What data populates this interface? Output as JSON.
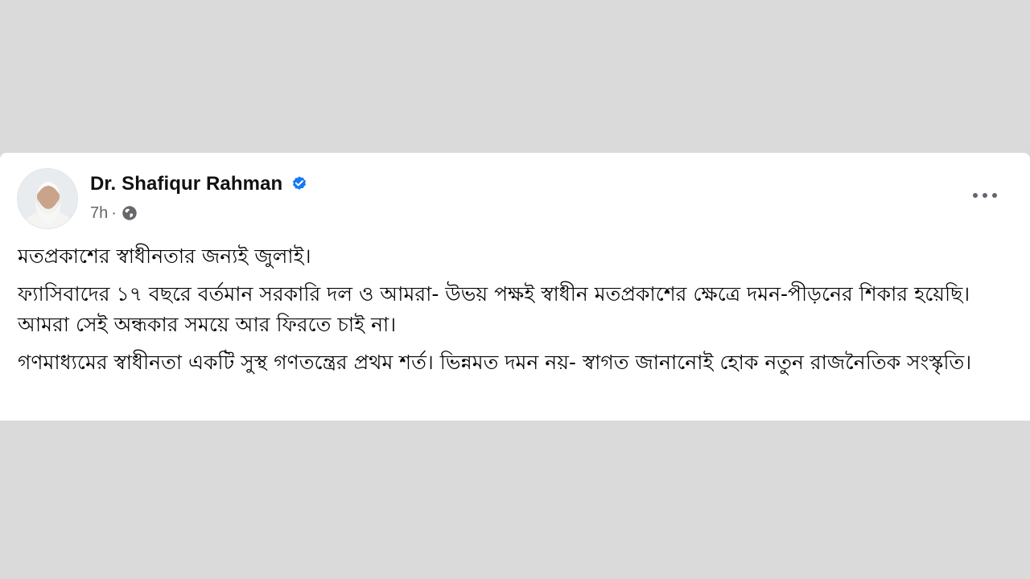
{
  "post": {
    "author_name": "Dr. Shafiqur Rahman",
    "verified_icon": "verified-badge-icon",
    "timestamp": "7h",
    "separator": "·",
    "audience_icon": "globe-icon",
    "more_icon": "more-options-icon",
    "paragraphs": [
      "মতপ্রকাশের স্বাধীনতার জন্যই জুলাই।",
      "ফ্যাসিবাদের ১৭ বছরে বর্তমান সরকারি দল ও আমরা- উভয় পক্ষই স্বাধীন মতপ্রকাশের ক্ষেত্রে দমন-পীড়নের শিকার হয়েছি। আমরা সেই অন্ধকার সময়ে আর ফিরতে চাই না।",
      "গণমাধ্যমের স্বাধীনতা একটি সুস্থ গণতন্ত্রের প্রথম শর্ত। ভিন্নমত দমন নয়- স্বাগত জানানোই হোক নতুন রাজনৈতিক সংস্কৃতি।"
    ]
  },
  "colors": {
    "background": "#dadada",
    "card": "#ffffff",
    "verified_blue": "#1877f2",
    "secondary_text": "#65676b",
    "primary_text": "#050505"
  }
}
